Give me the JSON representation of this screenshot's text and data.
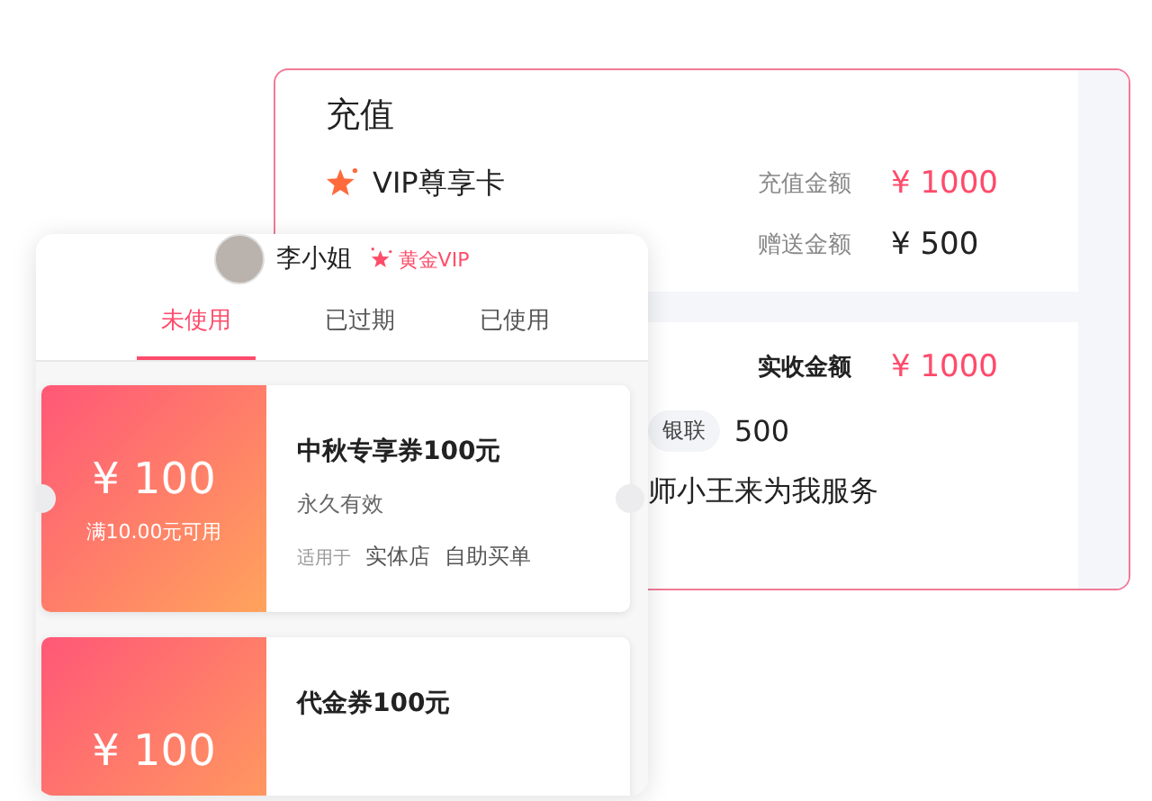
{
  "recharge_card": {
    "title": "充值",
    "product": {
      "name": "VIP尊享卡"
    },
    "amounts": [
      {
        "label": "充值金额",
        "value": "¥ 1000",
        "highlight": true
      },
      {
        "label": "赠送金额",
        "value": "¥ 500",
        "highlight": false
      }
    ],
    "received": {
      "label": "实收金额",
      "value": "¥ 1000",
      "highlight": true
    },
    "payment": {
      "method": "银联",
      "amount": "500"
    },
    "service_note": "师小王来为我服务"
  },
  "coupon_panel": {
    "user": {
      "name": "李小姐",
      "level": "黄金VIP"
    },
    "tabs": [
      {
        "label": "未使用",
        "selected": true
      },
      {
        "label": "已过期",
        "selected": false
      },
      {
        "label": "已使用",
        "selected": false
      }
    ],
    "coupons": [
      {
        "amount": "¥ 100",
        "condition": "满10.00元可用",
        "title": "中秋专享券100元",
        "validity": "永久有效",
        "scope_label": "适用于",
        "scopes": [
          "实体店",
          "自助买单"
        ]
      },
      {
        "amount": "¥ 100",
        "title": "代金券100元"
      }
    ]
  }
}
